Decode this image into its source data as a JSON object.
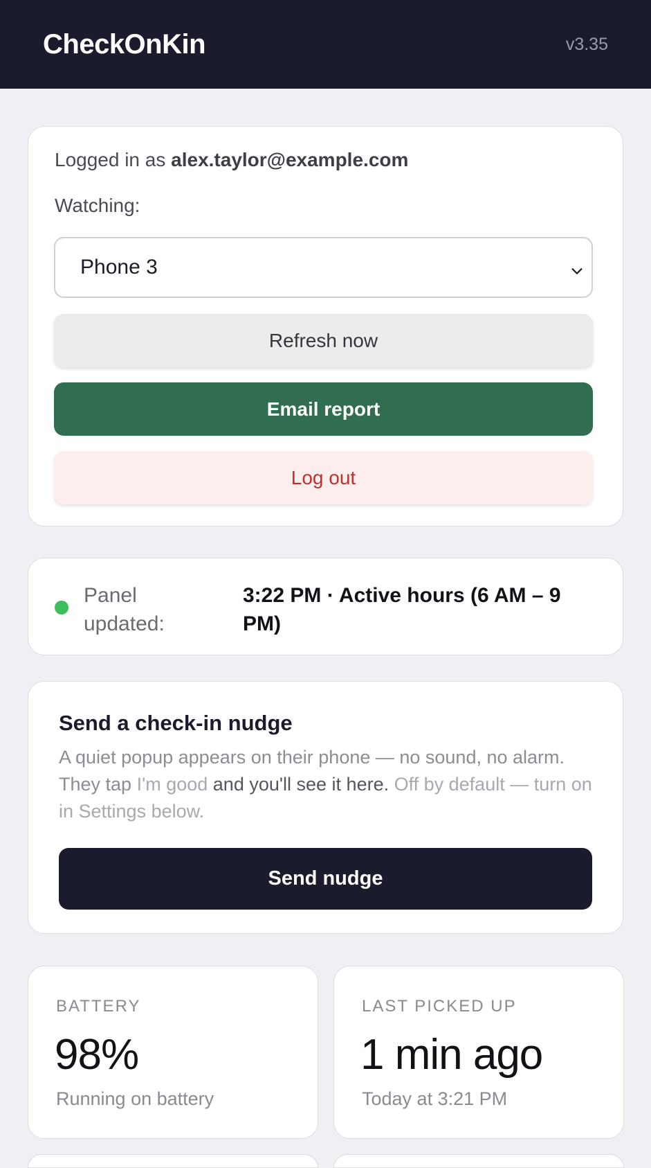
{
  "header": {
    "title": "CheckOnKin",
    "version": "v3.35"
  },
  "account": {
    "logged_prefix": "Logged in as ",
    "email": "alex.taylor@example.com",
    "watching_label": "Watching:",
    "selected_device": "Phone 3",
    "refresh_label": "Refresh now",
    "email_label": "Email report",
    "logout_label": "Log out"
  },
  "status": {
    "label": "Panel updated:",
    "value": "3:22 PM · Active hours (6 AM – 9 PM)",
    "indicator_color": "#3cbe5a"
  },
  "nudge": {
    "title": "Send a check-in nudge",
    "desc_part1": "A quiet popup appears on their phone — no sound, no alarm. They tap ",
    "desc_im_good": "I'm good",
    "desc_part2": " and you'll see it here.",
    "desc_part3": " Off by default — turn on in Settings below.",
    "button_label": "Send nudge"
  },
  "stats": [
    {
      "label": "BATTERY",
      "value": "98%",
      "sub": "Running on battery"
    },
    {
      "label": "LAST PICKED UP",
      "value": "1 min ago",
      "sub": "Today at 3:21 PM"
    }
  ],
  "colors": {
    "header_bg": "#1b1b2e",
    "email_button": "#316d51",
    "logout_text": "#c2302d",
    "logout_bg": "#fdeeee",
    "nudge_button": "#1b1b2e"
  }
}
